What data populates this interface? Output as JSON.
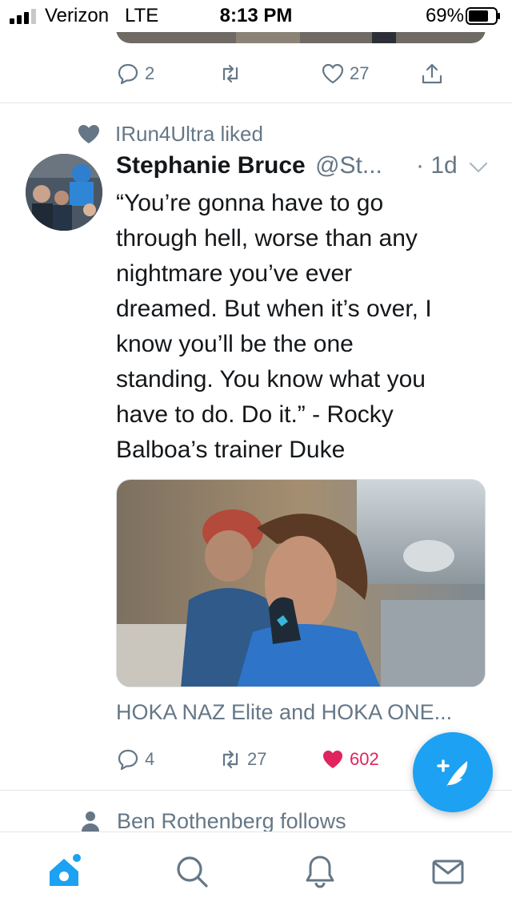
{
  "status_bar": {
    "carrier": "Verizon",
    "network": "LTE",
    "time": "8:13 PM",
    "battery_percent": "69%"
  },
  "previous_tweet": {
    "reply_count": "2",
    "retweet_count": "",
    "like_count": "27"
  },
  "tweet": {
    "social_context": "IRun4Ultra liked",
    "author_name": "Stephanie Bruce",
    "author_handle": "@St...",
    "timestamp": "· 1d",
    "text_lines": [
      "“You’re gonna have to go",
      "through hell, worse than any",
      "nightmare you’ve ever",
      "dreamed. But when it’s over, I",
      "know you’ll be the one",
      "standing. You know what you",
      "have to do. Do it.” - Rocky",
      "Balboa’s trainer Duke"
    ],
    "card_title": "HOKA NAZ Elite and HOKA ONE...",
    "reply_count": "4",
    "retweet_count": "27",
    "like_count": "602",
    "liked": true
  },
  "next_item": {
    "social_context": "Ben Rothenberg follows"
  },
  "colors": {
    "accent": "#1da1f2",
    "secondary_text": "#657786",
    "like": "#e0245e",
    "divider": "#e1e8ed"
  },
  "icons": {
    "compose_button": "compose-tweet-icon",
    "tabs": [
      "home-icon",
      "search-icon",
      "notifications-icon",
      "messages-icon"
    ]
  }
}
